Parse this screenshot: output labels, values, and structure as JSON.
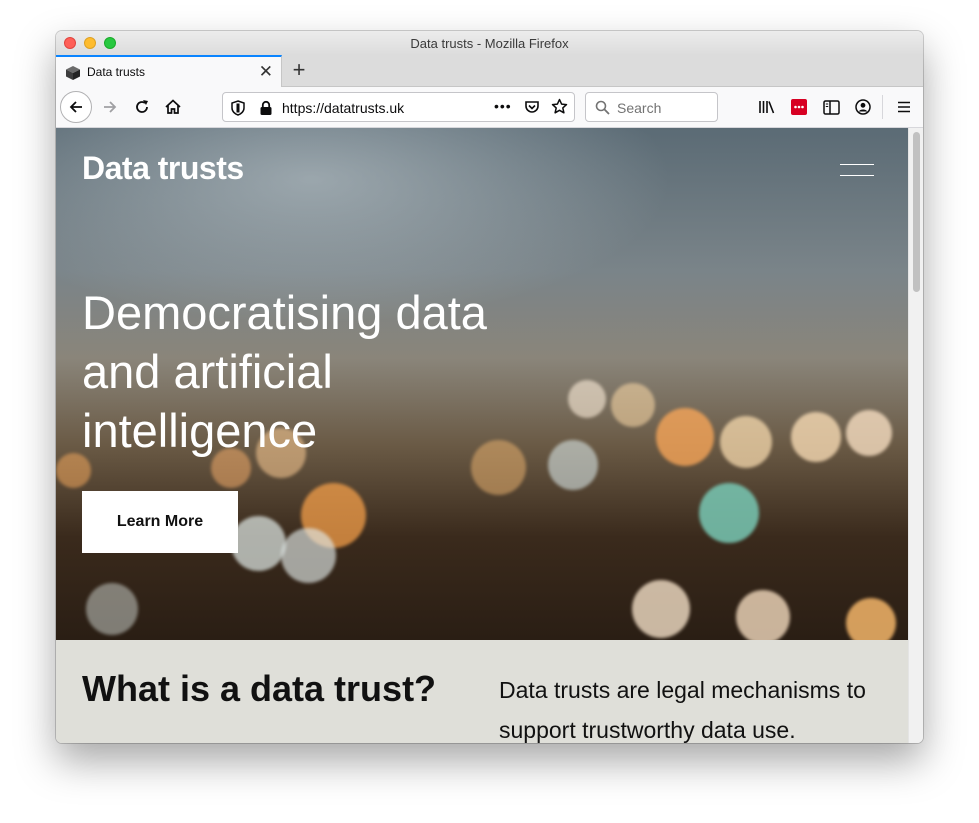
{
  "window": {
    "title": "Data trusts - Mozilla Firefox"
  },
  "tab": {
    "label": "Data trusts",
    "close_glyph": "✕",
    "new_tab_glyph": "+"
  },
  "navbar": {
    "url": "https://datatrusts.uk",
    "search_placeholder": "Search",
    "page_actions_glyph": "•••"
  },
  "site": {
    "title": "Data trusts",
    "hero_heading": "Democratising data and artificial intelligence",
    "cta_label": "Learn More",
    "about_title": "What is a data trust?",
    "about_text": "Data trusts are legal mechanisms to support trustworthy data use."
  },
  "colors": {
    "accent": "#0a84ff",
    "hero_text": "#ffffff",
    "section_bg": "#dfdfd9",
    "pocket_red": "#d70022"
  },
  "icons": [
    "back-icon",
    "forward-icon",
    "reload-icon",
    "home-icon",
    "shield-icon",
    "lock-icon",
    "pocket-icon",
    "bookmark-star-icon",
    "search-icon",
    "library-icon",
    "extension-icon",
    "sidebar-icon",
    "account-icon",
    "app-menu-icon",
    "hamburger-menu-icon"
  ]
}
